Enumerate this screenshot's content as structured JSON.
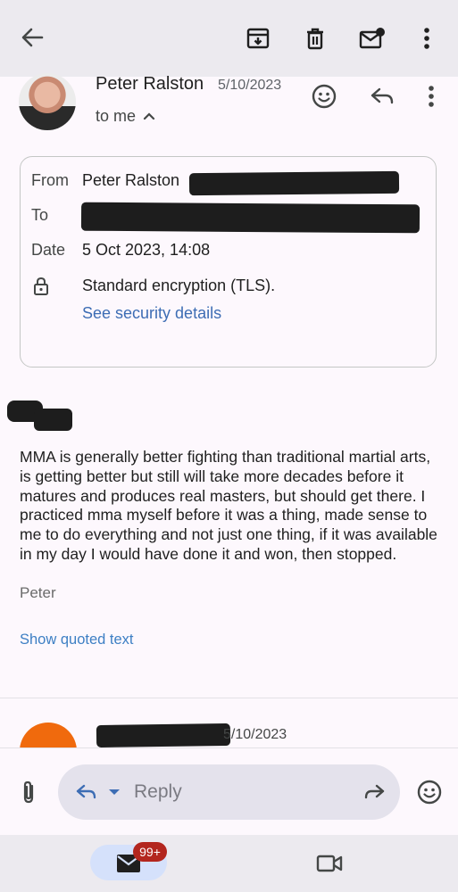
{
  "toolbar": {
    "back_icon": "arrow-back-icon",
    "archive_icon": "archive-icon",
    "delete_icon": "trash-icon",
    "mark_unread_icon": "mark-unread-icon",
    "more_icon": "more-vert-icon"
  },
  "header": {
    "sender_name": "Peter Ralston",
    "date": "5/10/2023",
    "recipient_label": "to me"
  },
  "details": {
    "from_label": "From",
    "from_value": "Peter Ralston",
    "to_label": "To",
    "date_label": "Date",
    "date_value": "5 Oct 2023, 14:08",
    "encryption_text": "Standard encryption (TLS).",
    "security_link": "See security details"
  },
  "body": {
    "text": "MMA is generally better fighting than traditional martial arts, is getting better but still will take more decades before it matures and produces real masters, but should get there. I practiced mma myself before it was a thing, made sense to me to do everything and not just one thing, if it was available in my day I would have done it and won, then stopped.",
    "signature": "Peter",
    "show_quoted": "Show quoted text"
  },
  "next_message": {
    "date": "5/10/2023",
    "avatar_color": "#f06a0d"
  },
  "reply_bar": {
    "placeholder": "Reply"
  },
  "bottom_nav": {
    "mail_badge": "99+"
  },
  "colors": {
    "accent_link": "#3d6db4",
    "badge": "#b3261e",
    "mail_pill": "#d5e1fb"
  }
}
